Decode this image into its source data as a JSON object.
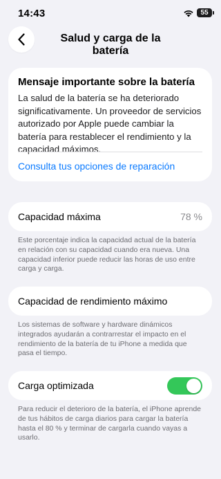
{
  "status_bar": {
    "time": "14:43",
    "battery_level": "55",
    "icons": [
      "wifi-icon",
      "battery-icon"
    ]
  },
  "nav": {
    "title": "Salud y carga de la batería",
    "back_icon": "chevron-left-icon"
  },
  "message": {
    "title": "Mensaje importante sobre la batería",
    "body": "La salud de la batería se ha deteriorado significativamente. Un proveedor de servicios autorizado por Apple puede cambiar la batería para restablecer el rendimiento y la capacidad máximos.",
    "link": "Consulta tus opciones de reparación"
  },
  "max_capacity": {
    "label": "Capacidad máxima",
    "value": "78 %",
    "footnote": "Este porcentaje indica la capacidad actual de la batería en relación con su capacidad cuando era nueva. Una capacidad inferior puede reducir las horas de uso entre carga y carga."
  },
  "peak_performance": {
    "label": "Capacidad de rendimiento máximo",
    "footnote": "Los sistemas de software y hardware dinámicos integrados ayudarán a contrarrestar el impacto en el rendimiento de la batería de tu iPhone a medida que pasa el tiempo."
  },
  "optimized_charging": {
    "label": "Carga optimizada",
    "enabled": true,
    "footnote": "Para reducir el deterioro de la batería, el iPhone aprende de tus hábitos de carga diarios para cargar la batería hasta el 80 % y terminar de cargarla cuando vayas a usarlo."
  },
  "colors": {
    "background": "#f2f2f7",
    "link": "#0a7aff",
    "toggle_on": "#34c759",
    "secondary_text": "#6d6d72"
  }
}
